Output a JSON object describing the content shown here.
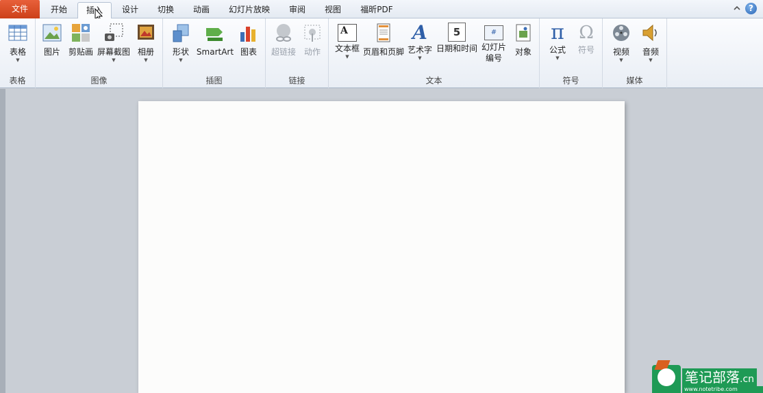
{
  "tabs": {
    "file": "文件",
    "home": "开始",
    "insert": "插入",
    "design": "设计",
    "transitions": "切换",
    "animations": "动画",
    "slideshow": "幻灯片放映",
    "review": "审阅",
    "view": "视图",
    "foxit": "福昕PDF"
  },
  "ribbon": {
    "table": {
      "group": "表格",
      "table_btn": "表格"
    },
    "images": {
      "group": "图像",
      "picture": "图片",
      "clipart": "剪贴画",
      "screenshot": "屏幕截图",
      "album": "相册"
    },
    "illustrations": {
      "group": "插图",
      "shapes": "形状",
      "smartart": "SmartArt",
      "chart": "图表"
    },
    "links": {
      "group": "链接",
      "hyperlink": "超链接",
      "action": "动作"
    },
    "text": {
      "group": "文本",
      "textbox": "文本框",
      "header_footer": "页眉和页脚",
      "wordart": "艺术字",
      "datetime": "日期和时间",
      "slide_number_l1": "幻灯片",
      "slide_number_l2": "编号",
      "object": "对象"
    },
    "symbols": {
      "group": "符号",
      "equation": "公式",
      "symbol": "符号"
    },
    "media": {
      "group": "媒体",
      "video": "视频",
      "audio": "音频"
    }
  },
  "watermark": {
    "text": "笔记部落",
    "url": "www.notetribe.com",
    "suffix": ".cn"
  },
  "icons": {
    "help": "?",
    "datetime_digit": "5",
    "textbox_letter": "A",
    "slide_number_mark": "#",
    "pi": "π",
    "omega": "Ω"
  }
}
